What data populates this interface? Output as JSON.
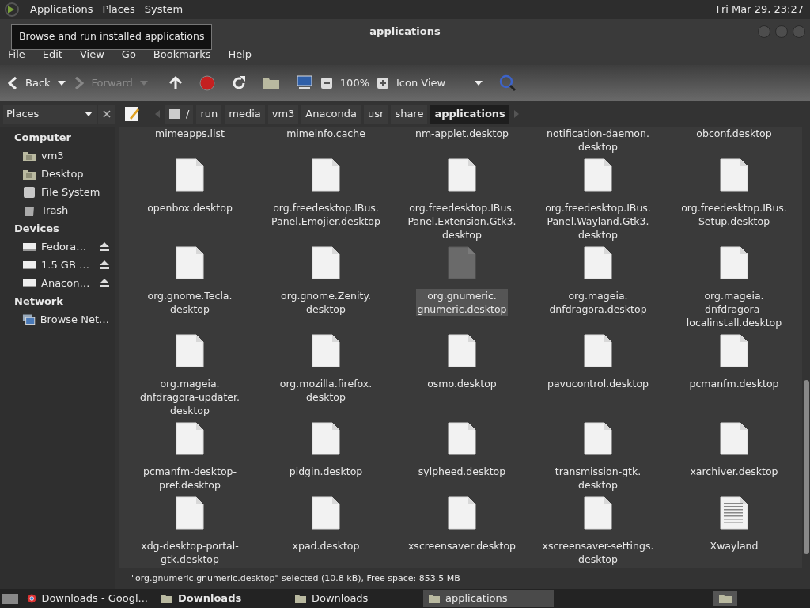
{
  "top_panel": {
    "menus": [
      "Applications",
      "Places",
      "System"
    ],
    "clock": "Fri Mar 29, 23:27"
  },
  "tooltip": "Browse and run installed applications",
  "window": {
    "title": "applications"
  },
  "menubar": [
    "File",
    "Edit",
    "View",
    "Go",
    "Bookmarks",
    "Help"
  ],
  "toolbar": {
    "back": {
      "label": "Back",
      "disabled": false
    },
    "forward": {
      "label": "Forward",
      "disabled": true
    },
    "zoom": "100%",
    "view_mode": "Icon View"
  },
  "side_pane": {
    "selector": "Places",
    "sections": [
      {
        "title": "Computer",
        "items": [
          {
            "kind": "home",
            "label": "vm3",
            "eject": false
          },
          {
            "kind": "desktop",
            "label": "Desktop",
            "eject": false
          },
          {
            "kind": "filesystem",
            "label": "File System",
            "eject": false
          },
          {
            "kind": "trash",
            "label": "Trash",
            "eject": false
          }
        ]
      },
      {
        "title": "Devices",
        "items": [
          {
            "kind": "drive",
            "label": "Fedora…",
            "eject": true
          },
          {
            "kind": "drive",
            "label": "1.5 GB …",
            "eject": true
          },
          {
            "kind": "drive",
            "label": "Anacon…",
            "eject": true
          }
        ]
      },
      {
        "title": "Network",
        "items": [
          {
            "kind": "network",
            "label": "Browse Net…",
            "eject": false
          }
        ]
      }
    ]
  },
  "path_bar": [
    {
      "label": "/",
      "root": true,
      "selected": false
    },
    {
      "label": "run",
      "root": false,
      "selected": false
    },
    {
      "label": "media",
      "root": false,
      "selected": false
    },
    {
      "label": "vm3",
      "root": false,
      "selected": false
    },
    {
      "label": "Anaconda",
      "root": false,
      "selected": false
    },
    {
      "label": "usr",
      "root": false,
      "selected": false
    },
    {
      "label": "share",
      "root": false,
      "selected": false
    },
    {
      "label": "applications",
      "root": false,
      "selected": true
    }
  ],
  "files": [
    {
      "kind": "partial",
      "label": "mimeapps.list",
      "selected": false
    },
    {
      "kind": "partial",
      "label": "mimeinfo.cache",
      "selected": false
    },
    {
      "kind": "partial",
      "label": "nm-applet.desktop",
      "selected": false
    },
    {
      "kind": "partial",
      "label": "notification-daemon.\ndesktop",
      "selected": false
    },
    {
      "kind": "partial",
      "label": "obconf.desktop",
      "selected": false
    },
    {
      "kind": "file",
      "label": "openbox.desktop",
      "selected": false
    },
    {
      "kind": "file",
      "label": "org.freedesktop.IBus.\nPanel.Emojier.desktop",
      "selected": false
    },
    {
      "kind": "file",
      "label": "org.freedesktop.IBus.\nPanel.Extension.Gtk3.\ndesktop",
      "selected": false
    },
    {
      "kind": "file",
      "label": "org.freedesktop.IBus.\nPanel.Wayland.Gtk3.\ndesktop",
      "selected": false
    },
    {
      "kind": "file",
      "label": "org.freedesktop.IBus.\nSetup.desktop",
      "selected": false
    },
    {
      "kind": "file",
      "label": "org.gnome.Tecla.\ndesktop",
      "selected": false
    },
    {
      "kind": "file",
      "label": "org.gnome.Zenity.\ndesktop",
      "selected": false
    },
    {
      "kind": "file",
      "label": "org.gnumeric.\ngnumeric.desktop",
      "selected": true
    },
    {
      "kind": "file",
      "label": "org.mageia.\ndnfdragora.desktop",
      "selected": false
    },
    {
      "kind": "file",
      "label": "org.mageia.\ndnfdragora-\nlocalinstall.desktop",
      "selected": false
    },
    {
      "kind": "file",
      "label": "org.mageia.\ndnfdragora-updater.\ndesktop",
      "selected": false
    },
    {
      "kind": "file",
      "label": "org.mozilla.firefox.\ndesktop",
      "selected": false
    },
    {
      "kind": "file",
      "label": "osmo.desktop",
      "selected": false
    },
    {
      "kind": "file",
      "label": "pavucontrol.desktop",
      "selected": false
    },
    {
      "kind": "file",
      "label": "pcmanfm.desktop",
      "selected": false
    },
    {
      "kind": "file",
      "label": "pcmanfm-desktop-\npref.desktop",
      "selected": false
    },
    {
      "kind": "file",
      "label": "pidgin.desktop",
      "selected": false
    },
    {
      "kind": "file",
      "label": "sylpheed.desktop",
      "selected": false
    },
    {
      "kind": "file",
      "label": "transmission-gtk.\ndesktop",
      "selected": false
    },
    {
      "kind": "file",
      "label": "xarchiver.desktop",
      "selected": false
    },
    {
      "kind": "file",
      "label": "xdg-desktop-portal-\ngtk.desktop",
      "selected": false
    },
    {
      "kind": "file",
      "label": "xpad.desktop",
      "selected": false
    },
    {
      "kind": "file",
      "label": "xscreensaver.desktop",
      "selected": false
    },
    {
      "kind": "file",
      "label": "xscreensaver-settings.\ndesktop",
      "selected": false
    },
    {
      "kind": "text",
      "label": "Xwayland",
      "selected": false
    }
  ],
  "status_bar": "\"org.gnumeric.gnumeric.desktop\" selected (10.8 kB), Free space: 853.5 MB",
  "taskbar": [
    {
      "kind": "browser",
      "label": "Downloads - Googl...",
      "selected": false,
      "bold": false
    },
    {
      "kind": "folder",
      "label": "Downloads",
      "selected": false,
      "bold": true
    },
    {
      "kind": "folder",
      "label": "Downloads",
      "selected": false,
      "bold": false
    },
    {
      "kind": "folder",
      "label": "applications",
      "selected": true,
      "bold": false
    }
  ]
}
